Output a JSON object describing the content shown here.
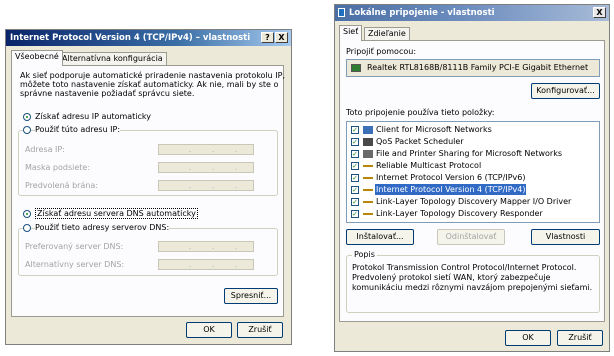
{
  "left_dialog": {
    "title": "Internet Protocol Version 4 (TCP/IPv4) – vlastnosti",
    "help_btn": "?",
    "close_btn": "X",
    "tabs": [
      "Všeobecné",
      "Alternatívna konfigurácia"
    ],
    "intro": [
      "Ak sieť podporuje automatické priradenie nastavenia protokolu IP,",
      "môžete toto nastavenie získať automaticky. Ak nie, mali by ste o",
      "správne nastavenie požiadať správcu siete."
    ],
    "radio_auto_ip": "Získať adresu IP automaticky",
    "radio_manual_ip": "Použiť túto adresu IP:",
    "field_ip": "Adresa IP:",
    "field_mask": "Maska podsiete:",
    "field_gateway": "Predvolená brána:",
    "radio_auto_dns": "Získať adresu servera DNS automaticky",
    "radio_manual_dns": "Použiť tieto adresy serverov DNS:",
    "field_pref_dns": "Preferovaný server DNS:",
    "field_alt_dns": "Alternatívny server DNS:",
    "advanced_btn": "Spresniť...",
    "ok_btn": "OK",
    "cancel_btn": "Zrušiť"
  },
  "right_dialog": {
    "title": "Lokálne pripojenie - vlastnosti",
    "close_btn": "X",
    "tabs": [
      "Sieť",
      "Zdieľanie"
    ],
    "connect_using_label": "Pripojiť pomocou:",
    "adapter_name": "Realtek RTL8168B/8111B Family PCI-E Gigabit Ethernet",
    "configure_btn": "Konfigurovať...",
    "items_label": "Toto pripojenie používa tieto položky:",
    "items": [
      "Client for Microsoft Networks",
      "QoS Packet Scheduler",
      "File and Printer Sharing for Microsoft Networks",
      "Reliable Multicast Protocol",
      "Internet Protocol Version 6 (TCP/IPv6)",
      "Internet Protocol Version 4 (TCP/IPv4)",
      "Link-Layer Topology Discovery Mapper I/O Driver",
      "Link-Layer Topology Discovery Responder"
    ],
    "install_btn": "Inštalovať...",
    "uninstall_btn": "Odinštalovať",
    "properties_btn": "Vlastnosti",
    "description_title": "Popis",
    "description": [
      "Protokol Transmission Control Protocol/Internet Protocol.",
      "Predvolený protokol sietí WAN, ktorý zabezpečuje",
      "komunikáciu medzi rôznymi navzájom prepojenými sieťami."
    ],
    "ok_btn": "OK",
    "cancel_btn": "Zrušiť"
  },
  "colors": {
    "title_blue": "#0a246a",
    "selection": "#316ac5",
    "face": "#ece9d8"
  }
}
